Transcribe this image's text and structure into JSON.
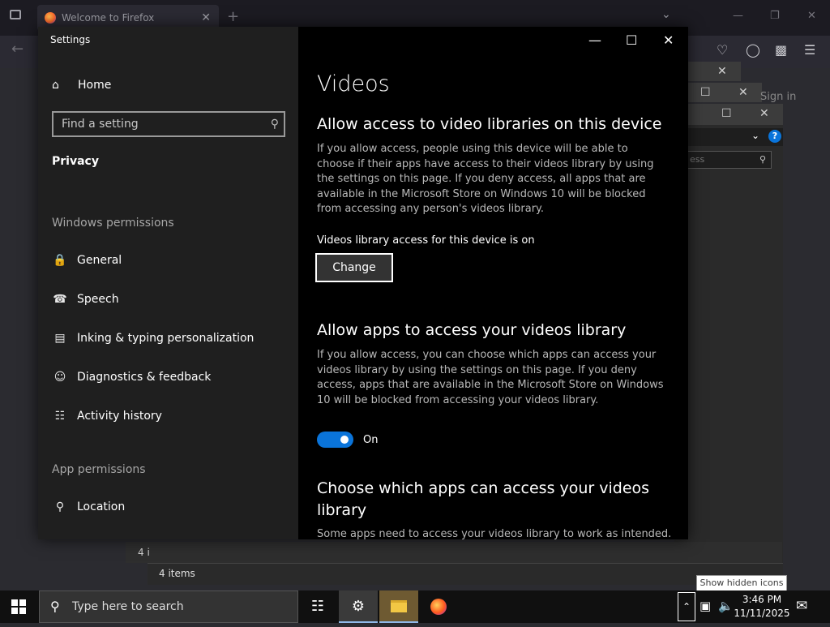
{
  "firefox": {
    "tab_title": "Welcome to Firefox",
    "tab_close": "✕",
    "new_tab": "+"
  },
  "background_windows": {
    "sign_in": "Sign in",
    "search_placeholder": "ess",
    "help": "?",
    "items_count_partial": "4 i",
    "items_count": "4 items"
  },
  "settings": {
    "window_title": "Settings",
    "home": "Home",
    "search_placeholder": "Find a setting",
    "category": "Privacy",
    "section_windows_permissions": "Windows permissions",
    "nav_items": [
      {
        "label": "General",
        "icon": "lock-icon"
      },
      {
        "label": "Speech",
        "icon": "speech-icon"
      },
      {
        "label": "Inking & typing personalization",
        "icon": "clipboard-icon"
      },
      {
        "label": "Diagnostics & feedback",
        "icon": "feedback-icon"
      },
      {
        "label": "Activity history",
        "icon": "timeline-icon"
      }
    ],
    "section_app_permissions": "App permissions",
    "nav_location": "Location",
    "page_title": "Videos",
    "device_access_heading": "Allow access to video libraries on this device",
    "device_access_text": "If you allow access, people using this device will be able to choose if their apps have access to their videos library by using the settings on this page. If you deny access, all apps that are available in the Microsoft Store on Windows 10 will be blocked from accessing any person's videos library.",
    "device_access_status": "Videos library access for this device is on",
    "change_button": "Change",
    "apps_access_heading": "Allow apps to access your videos library",
    "apps_access_text": "If you allow access, you can choose which apps can access your videos library by using the settings on this page. If you deny access, apps that are available in the Microsoft Store on Windows 10 will be blocked from accessing your videos library.",
    "apps_toggle_state": "On",
    "choose_apps_heading": "Choose which apps can access your videos library",
    "choose_apps_text": "Some apps need to access your videos library to work as intended."
  },
  "taskbar": {
    "search_placeholder": "Type here to search",
    "tooltip": "Show hidden icons",
    "time": "3:46 PM",
    "date": "11/11/2025"
  },
  "colors": {
    "accent": "#0a74da",
    "settings_sidebar": "#1f1f1f",
    "settings_content": "#000000"
  }
}
